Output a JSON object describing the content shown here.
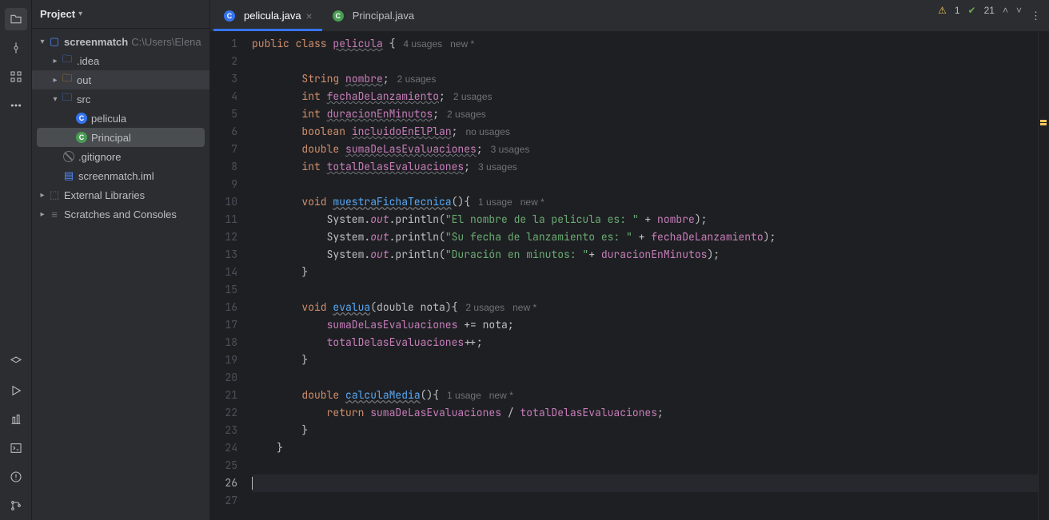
{
  "project_panel": {
    "title": "Project",
    "tree": {
      "root": {
        "name": "screenmatch",
        "path": "C:\\Users\\Elena"
      },
      "idea": ".idea",
      "out": "out",
      "src": "src",
      "pelicula": "pelicula",
      "principal": "Principal",
      "gitignore": ".gitignore",
      "iml": "screenmatch.iml",
      "external": "External Libraries",
      "scratches": "Scratches and Consoles"
    }
  },
  "tabs": [
    {
      "label": "pelicula.java",
      "active": true
    },
    {
      "label": "Principal.java",
      "active": false
    }
  ],
  "status": {
    "warnings": "1",
    "ok": "21"
  },
  "gutter": {
    "start": 1,
    "end": 27,
    "active": 26
  },
  "code": {
    "l1_pre": "public class ",
    "l1_cls": "pelicula",
    "l1_post": " {",
    "l1_hint": "   4 usages   new *",
    "l3a": "        String ",
    "l3b": "nombre",
    "l3c": ";",
    "l3h": "   2 usages",
    "l4a": "        int ",
    "l4b": "fechaDeLanzamiento",
    "l4c": ";",
    "l4h": "   2 usages",
    "l5a": "        int ",
    "l5b": "duracionEnMinutos",
    "l5c": ";",
    "l5h": "   2 usages",
    "l6a": "        boolean ",
    "l6b": "incluidoEnElPlan",
    "l6c": ";",
    "l6h": "   no usages",
    "l7a": "        double ",
    "l7b": "sumaDeLasEvaluaciones",
    "l7c": ";",
    "l7h": "   3 usages",
    "l8a": "        int ",
    "l8b": "totalDelasEvaluaciones",
    "l8c": ";",
    "l8h": "   3 usages",
    "l10a": "        void ",
    "l10b": "muestraFichaTecnica",
    "l10c": "(){",
    "l10h": "   1 usage   new *",
    "l11a": "            System.",
    "l11b": "out",
    "l11c": ".println(",
    "l11d": "\"El nombre de la pelicula es: \"",
    "l11e": " + ",
    "l11f": "nombre",
    "l11g": ");",
    "l12a": "            System.",
    "l12b": "out",
    "l12c": ".println(",
    "l12d": "\"Su fecha de lanzamiento es: \"",
    "l12e": " + ",
    "l12f": "fechaDeLanzamiento",
    "l12g": ");",
    "l13a": "            System.",
    "l13b": "out",
    "l13c": ".println(",
    "l13d": "\"Duración en minutos: \"",
    "l13e": "+ ",
    "l13f": "duracionEnMinutos",
    "l13g": ");",
    "l14": "        }",
    "l16a": "        void ",
    "l16b": "evalua",
    "l16c": "(double nota){",
    "l16h": "   2 usages   new *",
    "l17a": "            ",
    "l17b": "sumaDeLasEvaluaciones",
    "l17c": " += nota;",
    "l18a": "            ",
    "l18b": "totalDelasEvaluaciones",
    "l18c": "++;",
    "l19": "        }",
    "l21a": "        double ",
    "l21b": "calculaMedia",
    "l21c": "(){",
    "l21h": "   1 usage   new *",
    "l22a": "            return ",
    "l22b": "sumaDeLasEvaluaciones",
    "l22c": " / ",
    "l22d": "totalDelasEvaluaciones",
    "l22e": ";",
    "l23": "        }",
    "l24": "    }"
  }
}
